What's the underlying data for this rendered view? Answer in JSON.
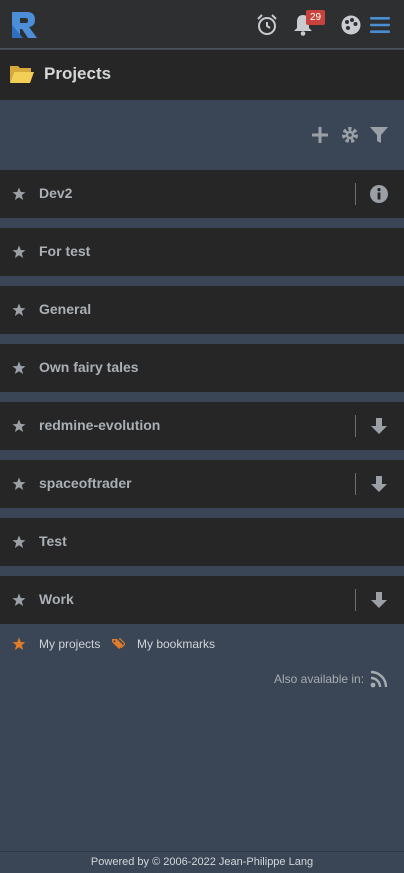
{
  "header": {
    "logo_icon": "redmine-logo-icon",
    "notifications_count": "29",
    "icons": [
      "alarm-clock-icon",
      "bell-icon",
      "palette-icon",
      "hamburger-menu-icon"
    ]
  },
  "page": {
    "title": "Projects",
    "title_icon": "folder-open-icon"
  },
  "toolbar": {
    "icons": [
      "plus-icon",
      "gear-icon",
      "filter-icon"
    ]
  },
  "projects": [
    {
      "name": "Dev2",
      "action_icon": "info-icon"
    },
    {
      "name": "For test",
      "action_icon": ""
    },
    {
      "name": "General",
      "action_icon": ""
    },
    {
      "name": "Own fairy tales",
      "action_icon": ""
    },
    {
      "name": "redmine-evolution",
      "action_icon": "download-arrow-icon"
    },
    {
      "name": "spaceoftrader",
      "action_icon": "download-arrow-icon"
    },
    {
      "name": "Test",
      "action_icon": ""
    },
    {
      "name": "Work",
      "action_icon": "download-arrow-icon"
    }
  ],
  "links": {
    "my_projects": "My projects",
    "my_bookmarks": "My bookmarks"
  },
  "also_available": "Also available in:",
  "footer": "Powered by © 2006-2022 Jean-Philippe Lang",
  "colors": {
    "accent_orange": "#e07b2a",
    "menu_blue": "#4a8fd6",
    "badge_red": "#c8433d"
  }
}
